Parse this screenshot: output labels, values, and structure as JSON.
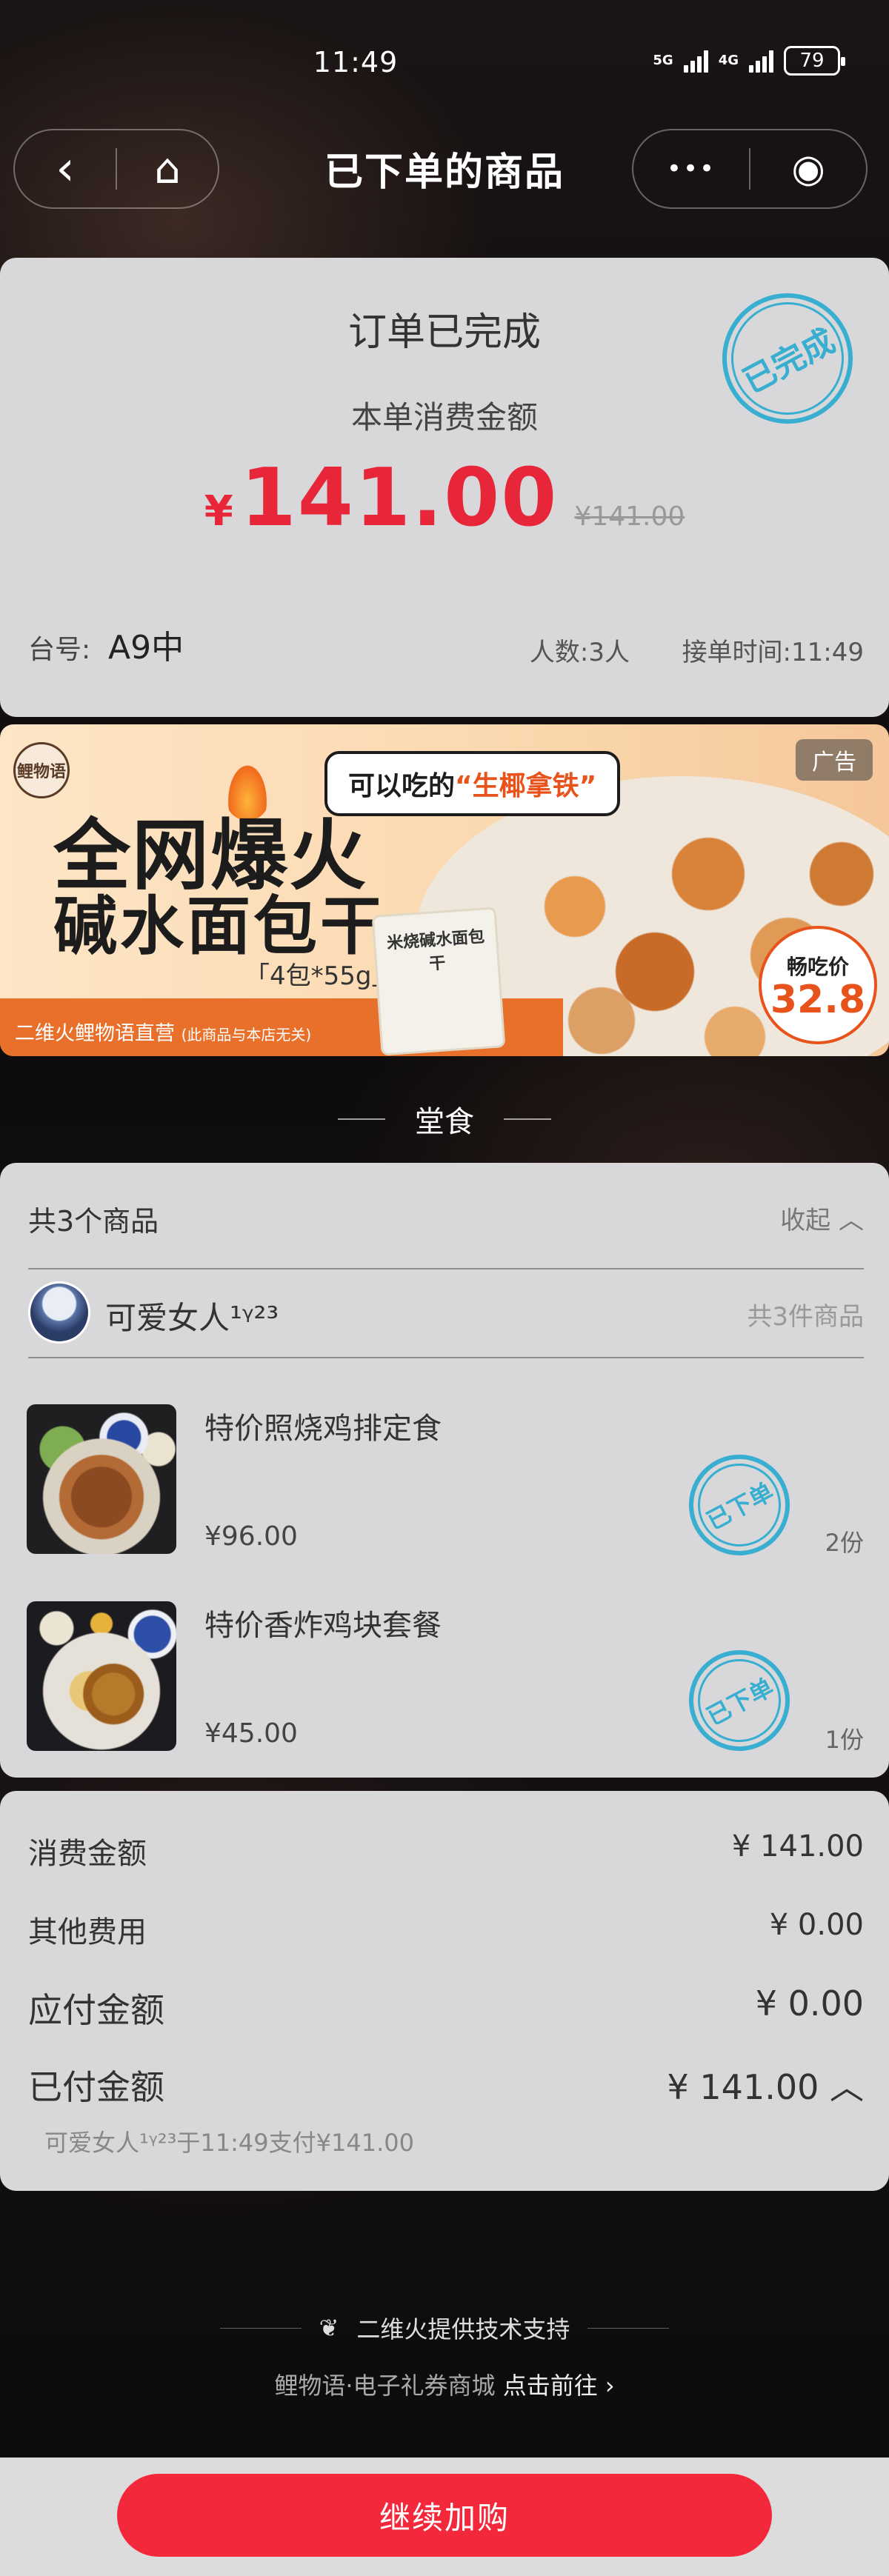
{
  "status_bar": {
    "time": "11:49",
    "net1": "5G",
    "net2": "4G",
    "battery": "79"
  },
  "nav": {
    "title": "已下单的商品",
    "back_icon": "‹",
    "home_icon": "⌂",
    "more_icon": "•••",
    "target_icon": "◉"
  },
  "order": {
    "status": "订单已完成",
    "amount_label": "本单消费金额",
    "currency": "¥",
    "amount": "141.00",
    "original_amount": "¥141.00",
    "stamp": "已完成",
    "table_label": "台号:",
    "table_value": "A9中",
    "people": "人数:3人",
    "received_time": "接单时间:11:49"
  },
  "ad": {
    "logo": "鲤物语",
    "headline1": "全网爆火",
    "headline2": "碱水面包干",
    "spec": "「4包*55g」",
    "bar_text": "二维火鲤物语直营",
    "bar_note": "(此商品与本店无关)",
    "bubble_pre": "可以吃的",
    "bubble_hl": "“生椰拿铁”",
    "pack_text": "米烧碱水面包干",
    "tag": "广告",
    "price_label": "畅吃价",
    "price": "32.8"
  },
  "section_title": "堂食",
  "items": {
    "count_label": "共3个商品",
    "collapse_label": "收起 ︿",
    "user_name": "可爱女人¹ᵞ²³",
    "user_total": "共3件商品",
    "list": [
      {
        "name": "特价照烧鸡排定食",
        "price": "¥96.00",
        "qty": "2份",
        "stamp": "已下单"
      },
      {
        "name": "特价香炸鸡块套餐",
        "price": "¥45.00",
        "qty": "1份",
        "stamp": "已下单"
      }
    ]
  },
  "bill": {
    "consume_label": "消费金额",
    "consume_value": "¥ 141.00",
    "other_label": "其他费用",
    "other_value": "¥ 0.00",
    "payable_label": "应付金额",
    "payable_value": "¥ 0.00",
    "paid_label": "已付金额",
    "paid_value": "¥ 141.00 ︿",
    "pay_note": "可爱女人¹ᵞ²³于11:49支付¥141.00"
  },
  "footer": {
    "tech": "二维火提供技术支持",
    "link_pre": "鲤物语·电子礼券商城",
    "link": "点击前往 ›"
  },
  "cta": "继续加购",
  "colors": {
    "accent": "#f4283b",
    "stamp": "#38aed0",
    "ad_orange": "#e8702a"
  }
}
